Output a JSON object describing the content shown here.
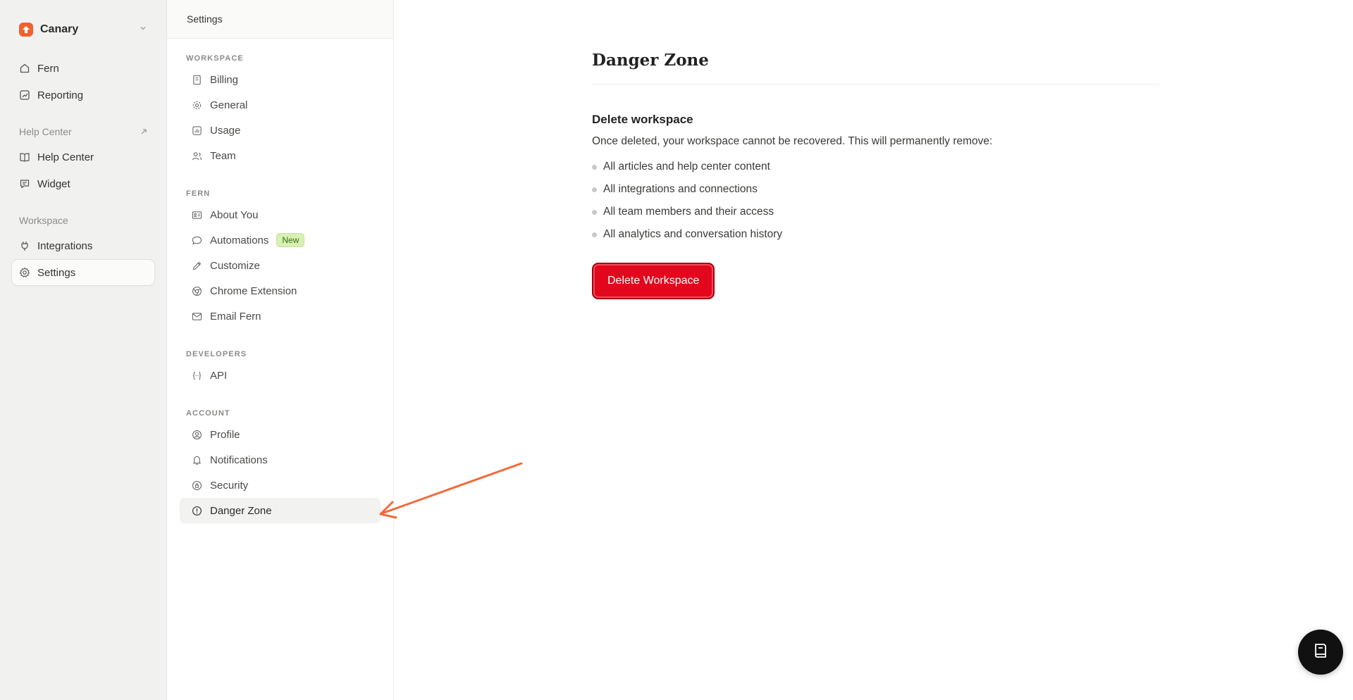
{
  "workspace": {
    "name": "Canary",
    "logo_color": "#f0622d"
  },
  "app_nav": {
    "items_top": [
      {
        "label": "Fern",
        "icon": "home-icon"
      },
      {
        "label": "Reporting",
        "icon": "chart-icon"
      }
    ],
    "help_center_section": "Help Center",
    "items_help": [
      {
        "label": "Help Center",
        "icon": "book-icon"
      },
      {
        "label": "Widget",
        "icon": "message-icon"
      }
    ],
    "workspace_section": "Workspace",
    "items_workspace": [
      {
        "label": "Integrations",
        "icon": "plug-icon"
      },
      {
        "label": "Settings",
        "icon": "gear-icon",
        "active": true
      }
    ]
  },
  "settings": {
    "header": "Settings",
    "groups": [
      {
        "title": "WORKSPACE",
        "items": [
          "Billing",
          "General",
          "Usage",
          "Team"
        ]
      },
      {
        "title": "FERN",
        "items": [
          "About You",
          "Automations",
          "Customize",
          "Chrome Extension",
          "Email Fern"
        ],
        "badge": "New"
      },
      {
        "title": "DEVELOPERS",
        "items": [
          "API"
        ]
      },
      {
        "title": "ACCOUNT",
        "items": [
          "Profile",
          "Notifications",
          "Security",
          "Danger Zone"
        ]
      }
    ],
    "active_item": "Danger Zone"
  },
  "main": {
    "title": "Danger Zone",
    "section_title": "Delete workspace",
    "description": "Once deleted, your workspace cannot be recovered. This will permanently remove:",
    "bullets": [
      "All articles and help center content",
      "All integrations and connections",
      "All team members and their access",
      "All analytics and conversation history"
    ],
    "button_label": "Delete Workspace",
    "button_color": "#e3071d"
  },
  "annotation": {
    "arrow_color": "#f26a3a"
  }
}
